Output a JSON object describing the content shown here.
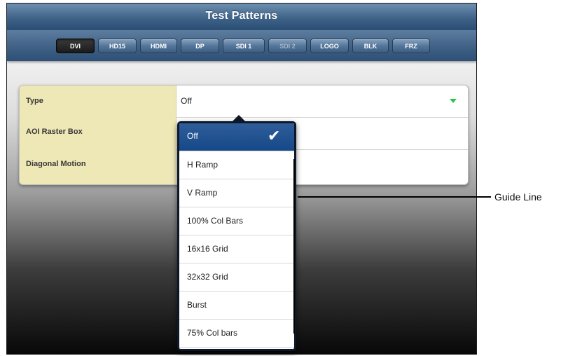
{
  "window": {
    "title": "Test Patterns"
  },
  "tabs": [
    {
      "label": "DVI",
      "state": "selected"
    },
    {
      "label": "HD15",
      "state": "normal"
    },
    {
      "label": "HDMI",
      "state": "normal"
    },
    {
      "label": "DP",
      "state": "normal"
    },
    {
      "label": "SDI 1",
      "state": "normal"
    },
    {
      "label": "SDI 2",
      "state": "disabled"
    },
    {
      "label": "LOGO",
      "state": "normal"
    },
    {
      "label": "BLK",
      "state": "normal"
    },
    {
      "label": "FRZ",
      "state": "normal"
    }
  ],
  "settings": {
    "rows": [
      {
        "label": "Type",
        "value": "Off",
        "control": "dropdown"
      },
      {
        "label": "AOI Raster Box",
        "control": "toggle"
      },
      {
        "label": "Diagonal Motion",
        "control": "toggle"
      }
    ]
  },
  "dropdown": {
    "selected_index": 0,
    "options": [
      {
        "label": "Off"
      },
      {
        "label": "H Ramp"
      },
      {
        "label": "V Ramp"
      },
      {
        "label": "100% Col Bars"
      },
      {
        "label": "16x16 Grid"
      },
      {
        "label": "32x32 Grid"
      },
      {
        "label": "Burst"
      },
      {
        "label": "75% Col bars"
      }
    ]
  },
  "annotation": {
    "label": "Guide Line"
  },
  "colors": {
    "header_blue": "#3e6387",
    "label_cell": "#eee7b6",
    "selected_option": "#1f4f8f",
    "dropdown_arrow": "#2fc24b"
  },
  "icons": {
    "check": "checkmark-icon",
    "dropdown_arrow": "chevron-down-icon"
  }
}
